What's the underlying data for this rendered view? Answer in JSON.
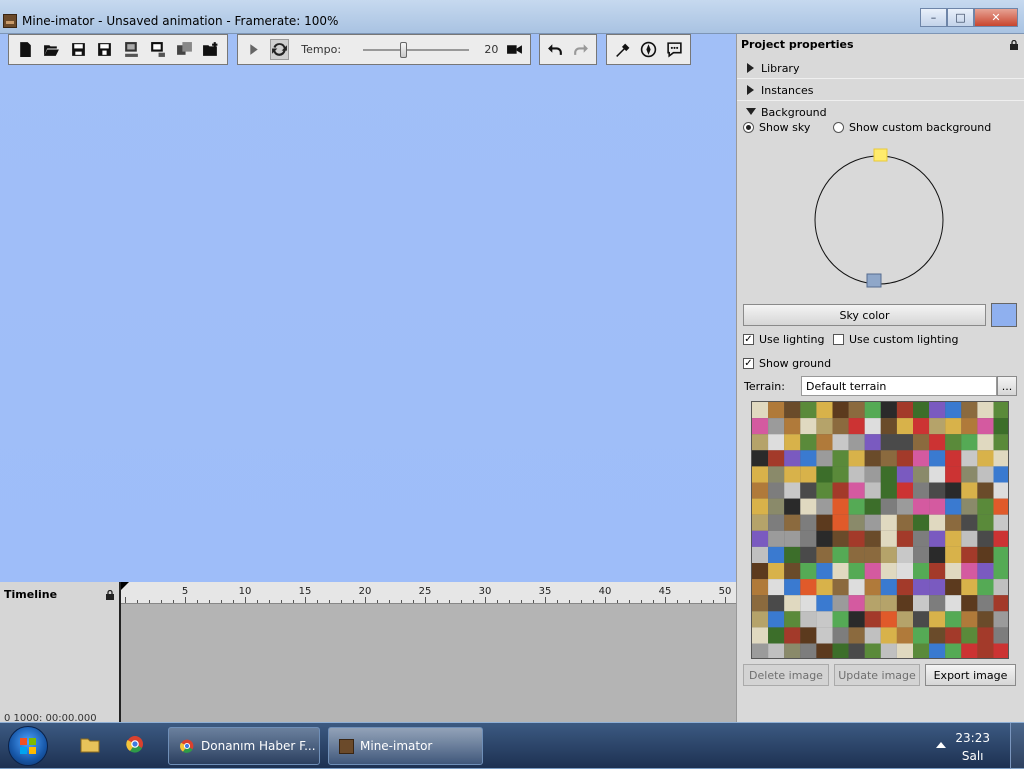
{
  "window": {
    "title": "Mine-imator - Unsaved animation - Framerate: 100%",
    "controls": [
      "minimize",
      "maximize",
      "close"
    ]
  },
  "toolbar": {
    "file_tools": [
      "new-icon",
      "open-icon",
      "save-icon",
      "save-as-icon",
      "render-movie-icon",
      "render-image-icon",
      "import-icon",
      "open-folder-icon"
    ],
    "playback": {
      "play_icon": "play-icon",
      "loop_icon": "loop-icon",
      "tempo_label": "Tempo:",
      "tempo_value": "20",
      "tempo_level": 0.37,
      "camera_icon": "camera-icon"
    },
    "history": [
      "undo-icon",
      "redo-icon"
    ],
    "extra": [
      "settings-icon",
      "compass-icon",
      "chat-icon"
    ]
  },
  "timeline": {
    "title": "Timeline",
    "ticks": [
      "5",
      "10",
      "15",
      "20",
      "25",
      "30",
      "35",
      "40",
      "45",
      "50"
    ],
    "footer": "0 1000: 00:00.000"
  },
  "panel": {
    "title": "Project properties",
    "sections": {
      "library": "Library",
      "instances": "Instances",
      "background": "Background"
    },
    "show_sky": "Show sky",
    "show_custom_background": "Show custom background",
    "sky_color_button": "Sky color",
    "sky_color": "#8fb0ef",
    "use_lighting": "Use lighting",
    "use_custom_lighting": "Use custom lighting",
    "show_ground": "Show ground",
    "terrain_label": "Terrain:",
    "terrain_value": "Default terrain",
    "terrain_more": "...",
    "delete_image": "Delete image",
    "update_image": "Update image",
    "export_image": "Export image"
  },
  "taskbar": {
    "items": [
      {
        "label": "Donanım Haber F..."
      },
      {
        "label": "Mine-imator"
      }
    ],
    "time": "23:23",
    "day": "Salı"
  }
}
